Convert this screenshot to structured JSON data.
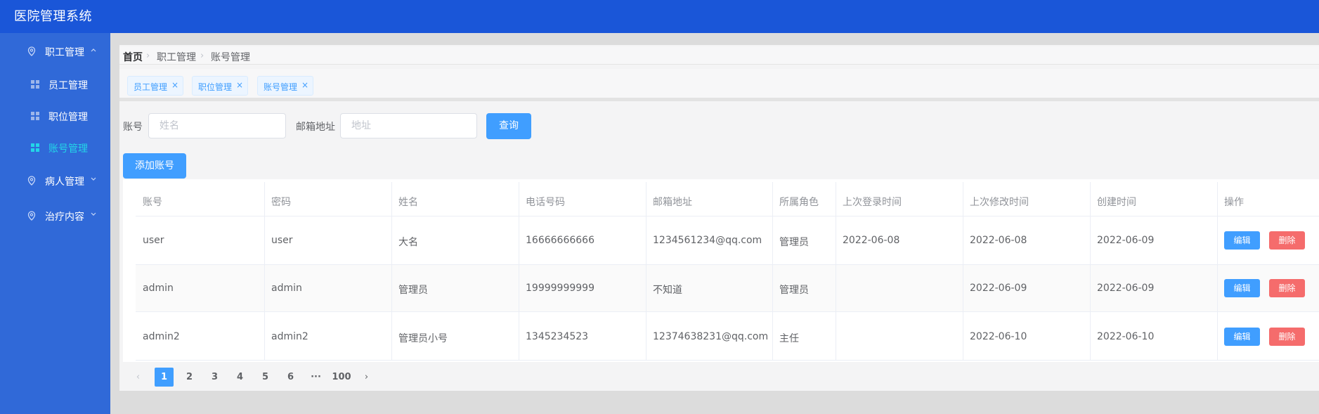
{
  "app": {
    "title": "医院管理系统"
  },
  "sidebar": {
    "groups": [
      {
        "label": "职工管理",
        "expanded": true
      },
      {
        "label": "病人管理",
        "expanded": false
      },
      {
        "label": "治疗内容",
        "expanded": false
      }
    ],
    "items": [
      {
        "label": "员工管理",
        "active": false
      },
      {
        "label": "职位管理",
        "active": false
      },
      {
        "label": "账号管理",
        "active": true
      }
    ]
  },
  "breadcrumb": [
    "首页",
    "职工管理",
    "账号管理"
  ],
  "tags": [
    {
      "label": "员工管理"
    },
    {
      "label": "职位管理"
    },
    {
      "label": "账号管理"
    }
  ],
  "search": {
    "account_label": "账号",
    "account_placeholder": "姓名",
    "email_label": "邮箱地址",
    "email_placeholder": "地址",
    "query_button": "查询",
    "add_button": "添加账号"
  },
  "table": {
    "columns": [
      "账号",
      "密码",
      "姓名",
      "电话号码",
      "邮箱地址",
      "所属角色",
      "上次登录时间",
      "上次修改时间",
      "创建时间",
      "操作"
    ],
    "rows": [
      [
        "user",
        "user",
        "大名",
        "16666666666",
        "1234561234@qq.com",
        "管理员",
        "2022-06-08",
        "2022-06-08",
        "2022-06-09"
      ],
      [
        "admin",
        "admin",
        "管理员",
        "19999999999",
        "不知道",
        "管理员",
        "",
        "2022-06-09",
        "2022-06-09"
      ],
      [
        "admin2",
        "admin2",
        "管理员小号",
        "1345234523",
        "12374638231@qq.com",
        "主任",
        "",
        "2022-06-10",
        "2022-06-10"
      ]
    ],
    "edit_label": "编辑",
    "delete_label": "删除"
  },
  "pagination": {
    "pages": [
      "1",
      "2",
      "3",
      "4",
      "5",
      "6",
      "···",
      "100"
    ],
    "current": "1",
    "prev_icon": "chevron-left-icon",
    "next_icon": "chevron-right-icon"
  },
  "colors": {
    "header": "#1a56d8",
    "sidebar": "#3069d8",
    "active_menu": "#23d5e8",
    "primary": "#409eff",
    "danger": "#f56c6c"
  }
}
